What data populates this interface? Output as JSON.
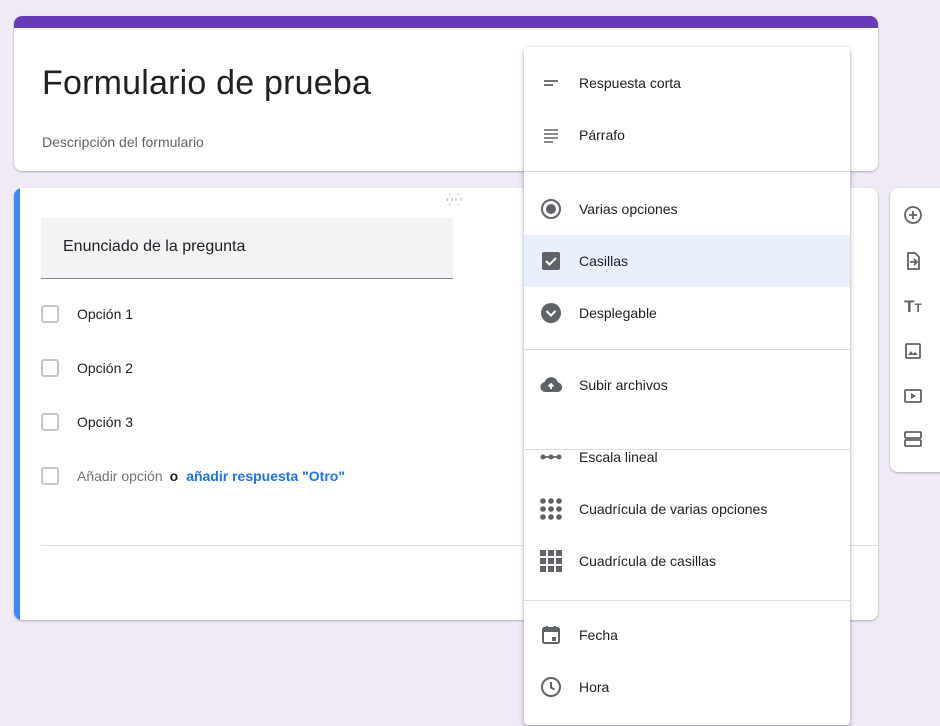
{
  "form": {
    "title": "Formulario de prueba",
    "description": "Descripción del formulario"
  },
  "question": {
    "title": "Enunciado de la pregunta",
    "options": [
      "Opción 1",
      "Opción 2",
      "Opción 3"
    ],
    "add_option": "Añadir opción",
    "or_text": "o",
    "add_other": "añadir respuesta \"Otro\""
  },
  "menu": {
    "items": [
      {
        "label": "Respuesta corta",
        "icon": "short-text-icon"
      },
      {
        "label": "Párrafo",
        "icon": "paragraph-icon"
      },
      {
        "label": "Varias opciones",
        "icon": "radio-button-icon"
      },
      {
        "label": "Casillas",
        "icon": "checkbox-icon",
        "selected": true
      },
      {
        "label": "Desplegable",
        "icon": "dropdown-icon"
      },
      {
        "label": "Subir archivos",
        "icon": "cloud-upload-icon"
      },
      {
        "label": "Escala lineal",
        "icon": "linear-scale-icon"
      },
      {
        "label": "Cuadrícula de varias opciones",
        "icon": "radio-grid-icon"
      },
      {
        "label": "Cuadrícula de casillas",
        "icon": "checkbox-grid-icon"
      },
      {
        "label": "Fecha",
        "icon": "calendar-icon"
      },
      {
        "label": "Hora",
        "icon": "clock-icon"
      }
    ]
  },
  "toolbar": {
    "icons": [
      "add-question-icon",
      "import-questions-icon",
      "add-title-icon",
      "add-image-icon",
      "add-video-icon",
      "add-section-icon"
    ]
  },
  "colors": {
    "accent": "#673ab7",
    "question_active": "#4285f4",
    "link": "#1a73e8",
    "selected_bg": "#e8f0fe",
    "page_bg": "#efeaf6"
  }
}
